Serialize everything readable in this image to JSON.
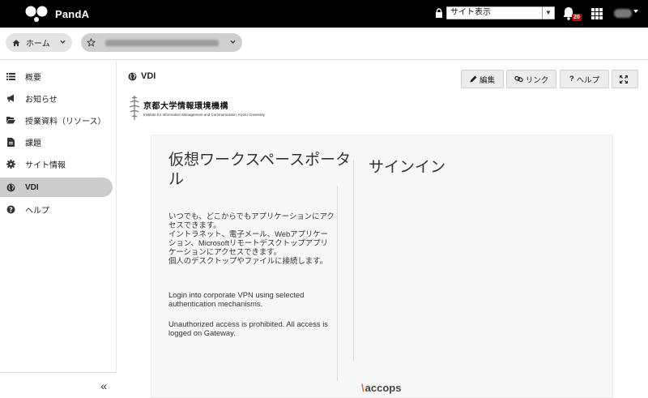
{
  "app": {
    "name": "PandA"
  },
  "topbar": {
    "site_view_select": "サイト表示",
    "notifications_count": "20"
  },
  "breadcrumb": {
    "home_label": "ホーム"
  },
  "sidebar": {
    "items": [
      {
        "label": "概要",
        "icon": "list-icon"
      },
      {
        "label": "お知らせ",
        "icon": "bullhorn-icon"
      },
      {
        "label": "授業資料（リソース）",
        "icon": "folder-open-icon"
      },
      {
        "label": "課題",
        "icon": "file-icon"
      },
      {
        "label": "サイト情報",
        "icon": "gear-icon"
      },
      {
        "label": "VDI",
        "icon": "globe-icon",
        "active": true
      },
      {
        "label": "ヘルプ",
        "icon": "question-circle-icon"
      }
    ],
    "collapse_label": "«"
  },
  "tool": {
    "title": "VDI",
    "buttons": {
      "edit": "編集",
      "link": "リンク",
      "help": "ヘルプ"
    }
  },
  "kyoto": {
    "name": "京都大学情報環境機構",
    "subtitle": "Institute for Information Management and Communication, Kyoto University"
  },
  "portal": {
    "title": "仮想ワークスペースポータル",
    "signin": "サインイン",
    "desc_lines": [
      "いつでも、どこからでもアプリケーションにアク",
      "セスできます。",
      "イントラネット、電子メール、Webアプリケー",
      "ション、Microsoftリモートデスクトップアプリ",
      "ケーションにアクセスできます。",
      "個人のデスクトップやファイルに接続します。"
    ],
    "en_lines_1": [
      "Login into corporate VPN using selected",
      "authentication mechanisms."
    ],
    "en_lines_2": [
      "Unauthorized access is prohibited. All access is",
      "logged on Gateway."
    ],
    "brand": "accops"
  },
  "colors": {
    "topbar": "#000000",
    "active_nav": "#cdcdcd",
    "accent": "#e8641b",
    "badge": "#cc0000"
  }
}
